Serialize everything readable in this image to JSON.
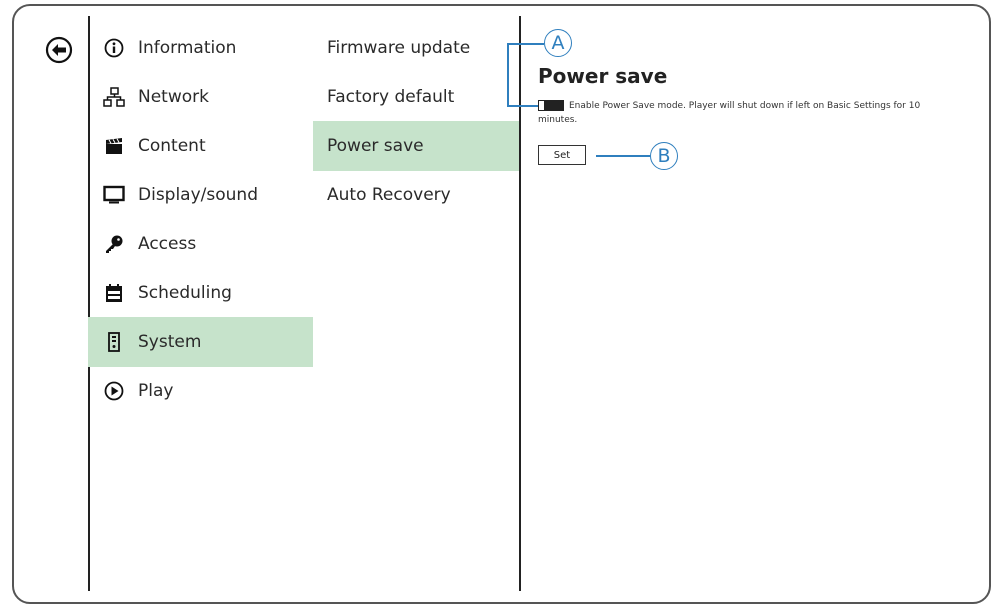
{
  "nav": {
    "back_icon": "back-arrow-icon",
    "items": [
      {
        "label": "Information",
        "icon": "info-icon"
      },
      {
        "label": "Network",
        "icon": "network-icon"
      },
      {
        "label": "Content",
        "icon": "clapperboard-icon"
      },
      {
        "label": "Display/sound",
        "icon": "monitor-icon"
      },
      {
        "label": "Access",
        "icon": "key-icon"
      },
      {
        "label": "Scheduling",
        "icon": "calendar-icon"
      },
      {
        "label": "System",
        "icon": "system-icon",
        "active": true
      },
      {
        "label": "Play",
        "icon": "play-icon"
      }
    ]
  },
  "submenu": {
    "items": [
      {
        "label": "Firmware update"
      },
      {
        "label": "Factory default"
      },
      {
        "label": "Power save",
        "active": true
      },
      {
        "label": "Auto Recovery"
      }
    ]
  },
  "panel": {
    "title": "Power save",
    "toggle_description": "Enable Power Save mode. Player will shut down if left on Basic Settings for 10 minutes.",
    "set_label": "Set"
  },
  "callouts": {
    "a": "A",
    "b": "B",
    "color": "#2f7fbe"
  },
  "colors": {
    "active_bg": "#c6e3cb"
  }
}
